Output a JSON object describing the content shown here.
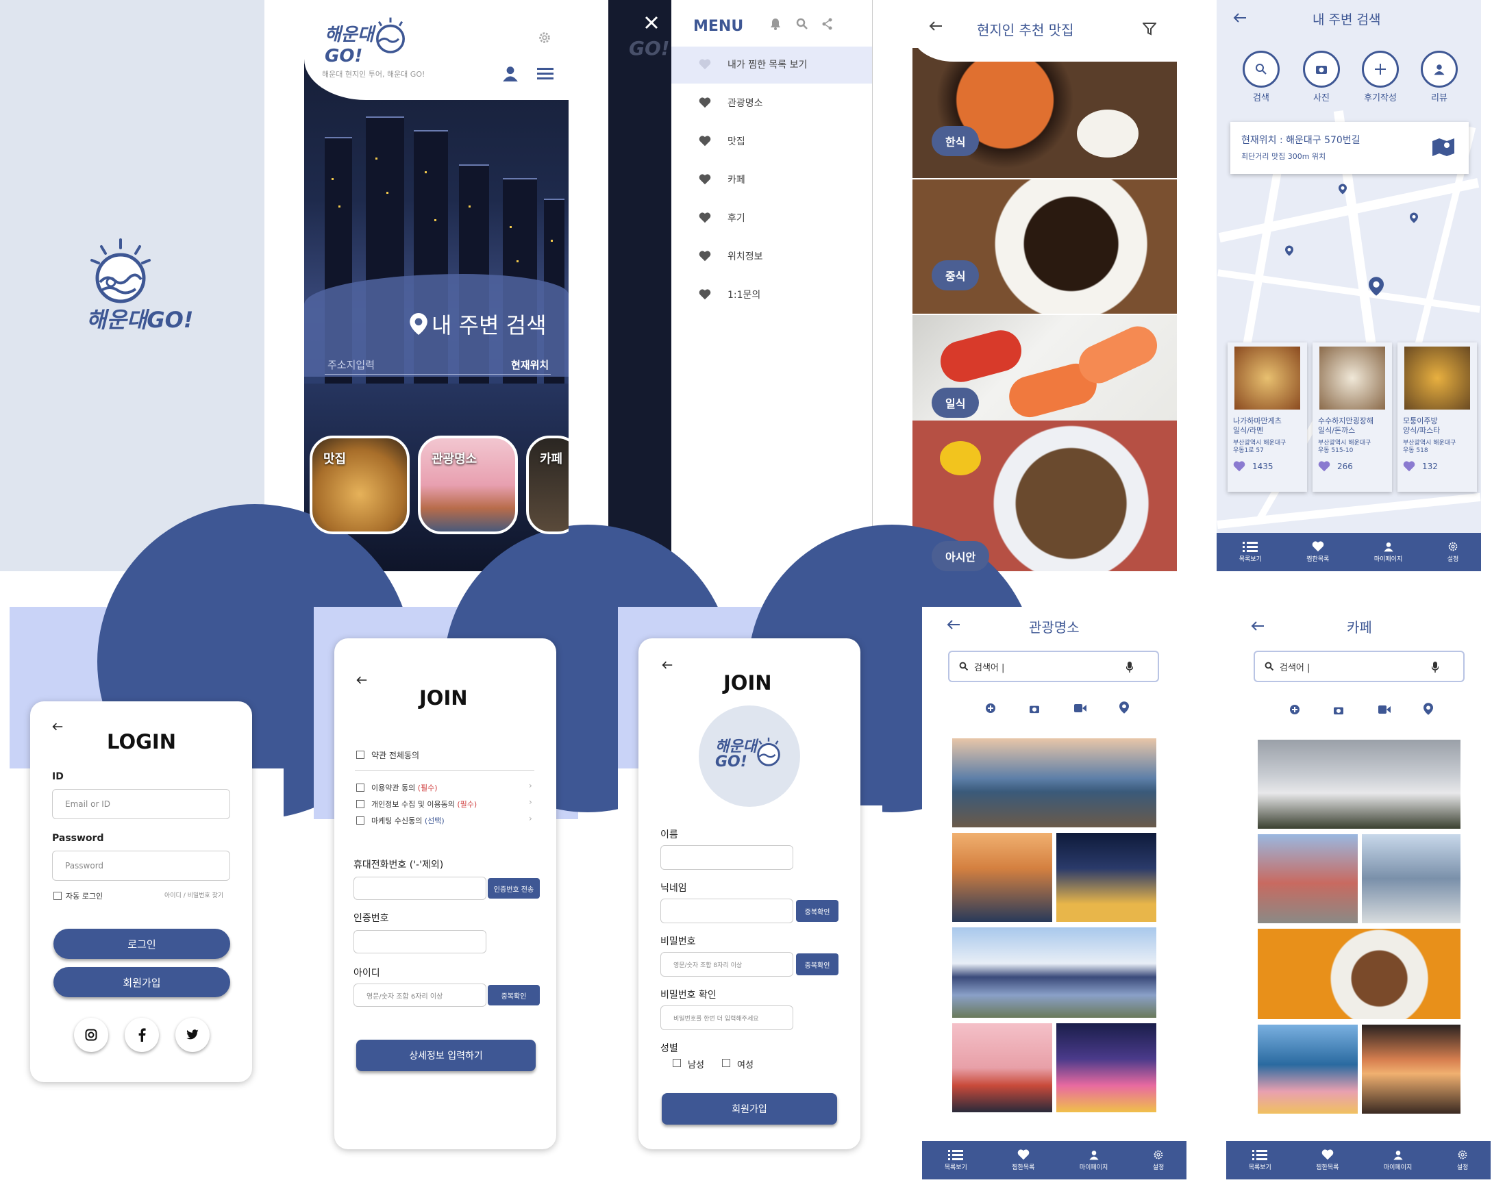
{
  "splash": {
    "brand": "해운대GO!"
  },
  "home": {
    "slogan": "해운대 현지인 투어, 해운대 GO!",
    "search_title": "내 주변 검색",
    "address_input": "주소지입력",
    "current_location": "현재위치",
    "cards": [
      "맛집",
      "관광명소",
      "카페"
    ]
  },
  "menu": {
    "title": "MENU",
    "items": [
      "내가 찜한 목록 보기",
      "관광명소",
      "맛집",
      "카페",
      "후기",
      "위치정보",
      "1:1문의"
    ]
  },
  "food": {
    "title": "현지인 추천 맛집",
    "categories": [
      "한식",
      "중식",
      "일식",
      "아시안"
    ]
  },
  "map": {
    "title": "내 주변 검색",
    "actions": [
      "검색",
      "사진",
      "후기작성",
      "리뷰"
    ],
    "location_line1": "현재위치 : 해운대구 570번길",
    "location_line2": "최단거리 맛집 300m 위치",
    "places": [
      {
        "name": "나가하마만게츠",
        "type": "일식/라멘",
        "addr1": "부산광역시 해운대구",
        "addr2": "우동1로 57",
        "likes": "1435"
      },
      {
        "name": "수수하지만굉장해",
        "type": "일식/돈까스",
        "addr1": "부산광역시 해운대구",
        "addr2": "우동 515-10",
        "likes": "266"
      },
      {
        "name": "모퉁이주방",
        "type": "양식/파스타",
        "addr1": "부산광역시 해운대구",
        "addr2": "우동 518",
        "likes": "132"
      }
    ]
  },
  "tabs": [
    "목록보기",
    "찜한목록",
    "마이페이지",
    "설정"
  ],
  "login": {
    "title": "LOGIN",
    "id_label": "ID",
    "id_placeholder": "Email or ID",
    "pw_label": "Password",
    "pw_placeholder": "Password",
    "auto_login": "자동 로그인",
    "find": "아이디 / 비밀번호 찾기",
    "login_btn": "로그인",
    "signup_btn": "회원가입"
  },
  "join1": {
    "title": "JOIN",
    "agree_all": "약관 전체동의",
    "terms": [
      {
        "text": "이용약관 동의",
        "tag": "(필수)"
      },
      {
        "text": "개인정보 수집 및 이용동의",
        "tag": "(필수)"
      },
      {
        "text": "마케팅 수신동의",
        "tag": "(선택)"
      }
    ],
    "phone_label": "휴대전화번호 ('-'제외)",
    "send_code": "인증번호 전송",
    "code_label": "인증번호",
    "id_label": "아이디",
    "id_placeholder": "영문/숫자 조합 6자리 이상",
    "dup_check": "중복확인",
    "next_btn": "상세정보 입력하기"
  },
  "join2": {
    "title": "JOIN",
    "name_label": "이름",
    "nick_label": "닉네임",
    "dup_check": "중복확인",
    "pw_label": "비밀번호",
    "pw_placeholder": "영문/숫자 조합 8자리 이상",
    "pw_check": "중복확인",
    "pw2_label": "비밀번호 확인",
    "pw2_placeholder": "비밀번호를 한번 더 입력해주세요",
    "gender_label": "성별",
    "male": "남성",
    "female": "여성",
    "submit": "회원가입"
  },
  "tour": {
    "title": "관광명소",
    "search_placeholder": "검색어 |"
  },
  "cafe": {
    "title": "카페",
    "search_placeholder": "검색어 |"
  },
  "colors": {
    "navy": "#3e5794",
    "lavender": "#c9d3f7",
    "bg": "#dfe5ef"
  }
}
